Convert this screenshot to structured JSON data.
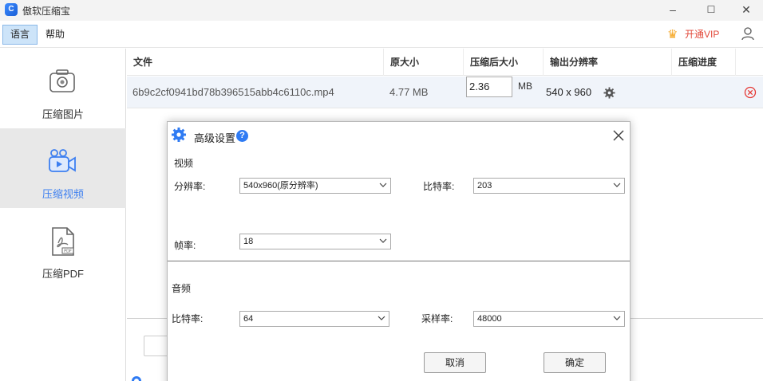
{
  "app": {
    "title": "傲软压缩宝",
    "icon_letter": "C"
  },
  "window_controls": {
    "minimize": "–",
    "maximize": "☐",
    "close": "✕"
  },
  "menu": {
    "language": "语言",
    "help": "帮助",
    "vip": "开通VIP"
  },
  "sidebar": {
    "items": [
      {
        "label": "压缩图片",
        "icon": "camera-icon",
        "active": false
      },
      {
        "label": "压缩视频",
        "icon": "video-camera-icon",
        "active": true
      },
      {
        "label": "压缩PDF",
        "icon": "pdf-icon",
        "active": false
      }
    ]
  },
  "table": {
    "headers": [
      "文件",
      "原大小",
      "压缩后大小",
      "输出分辨率",
      "压缩进度"
    ],
    "rows": [
      {
        "file": "6b9c2cf0941bd78b396515abb4c6110c.mp4",
        "original_size": "4.77 MB",
        "compressed_size": "2.36",
        "unit": "MB",
        "resolution": "540 x 960"
      }
    ]
  },
  "dialog": {
    "title": "高级设置",
    "video_section": "视频",
    "resolution_label": "分辨率:",
    "resolution_value": "540x960(原分辨率)",
    "video_bitrate_label": "比特率:",
    "video_bitrate_value": "203",
    "framerate_label": "帧率:",
    "framerate_value": "18",
    "audio_section": "音频",
    "audio_bitrate_label": "比特率:",
    "audio_bitrate_value": "64",
    "sample_rate_label": "采样率:",
    "sample_rate_value": "48000",
    "cancel": "取消",
    "confirm": "确定"
  },
  "colors": {
    "accent": "#2f7bf3",
    "vip": "#e24a3b",
    "active_sidebar": "#e8e8e8",
    "row_bg": "#f0f4fa"
  }
}
